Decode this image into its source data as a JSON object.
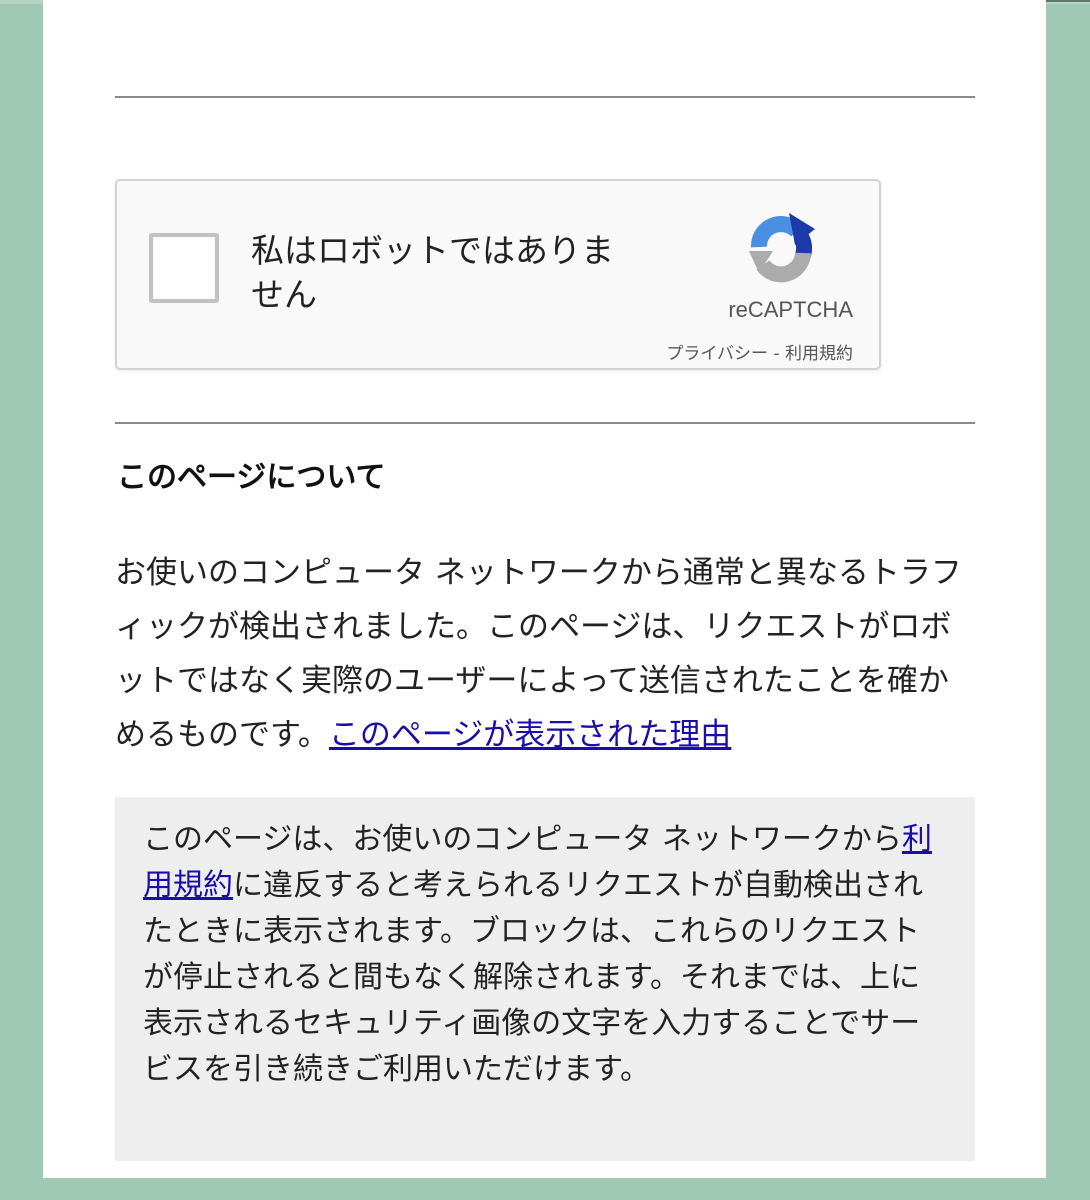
{
  "recaptcha": {
    "checkbox_label": "私はロボットではありません",
    "brand": "reCAPTCHA",
    "privacy_link": "プライバシー",
    "separator": " - ",
    "terms_link": "利用規約"
  },
  "about": {
    "heading": "このページについて",
    "paragraph": "お使いのコンピュータ ネットワークから通常と異なるトラフィックが検出されました。このページは、リクエストがロボットではなく実際のユーザーによって送信されたことを確かめるものです。",
    "why_link": "このページが表示された理由"
  },
  "notice": {
    "text_before": "このページは、お使いのコンピュータ ネットワークから",
    "terms_link": "利用規約",
    "text_after": "に違反すると考えられるリクエストが自動検出されたときに表示されます。ブロックは、これらのリクエストが停止されると間もなく解除されます。それまでは、上に表示されるセキュリティ画像の文字を入力することでサービスを引き続きご利用いただけます。"
  },
  "colors": {
    "background": "#9fc9b5",
    "link": "#1a0dab",
    "notice_bg": "#eeeeee"
  }
}
